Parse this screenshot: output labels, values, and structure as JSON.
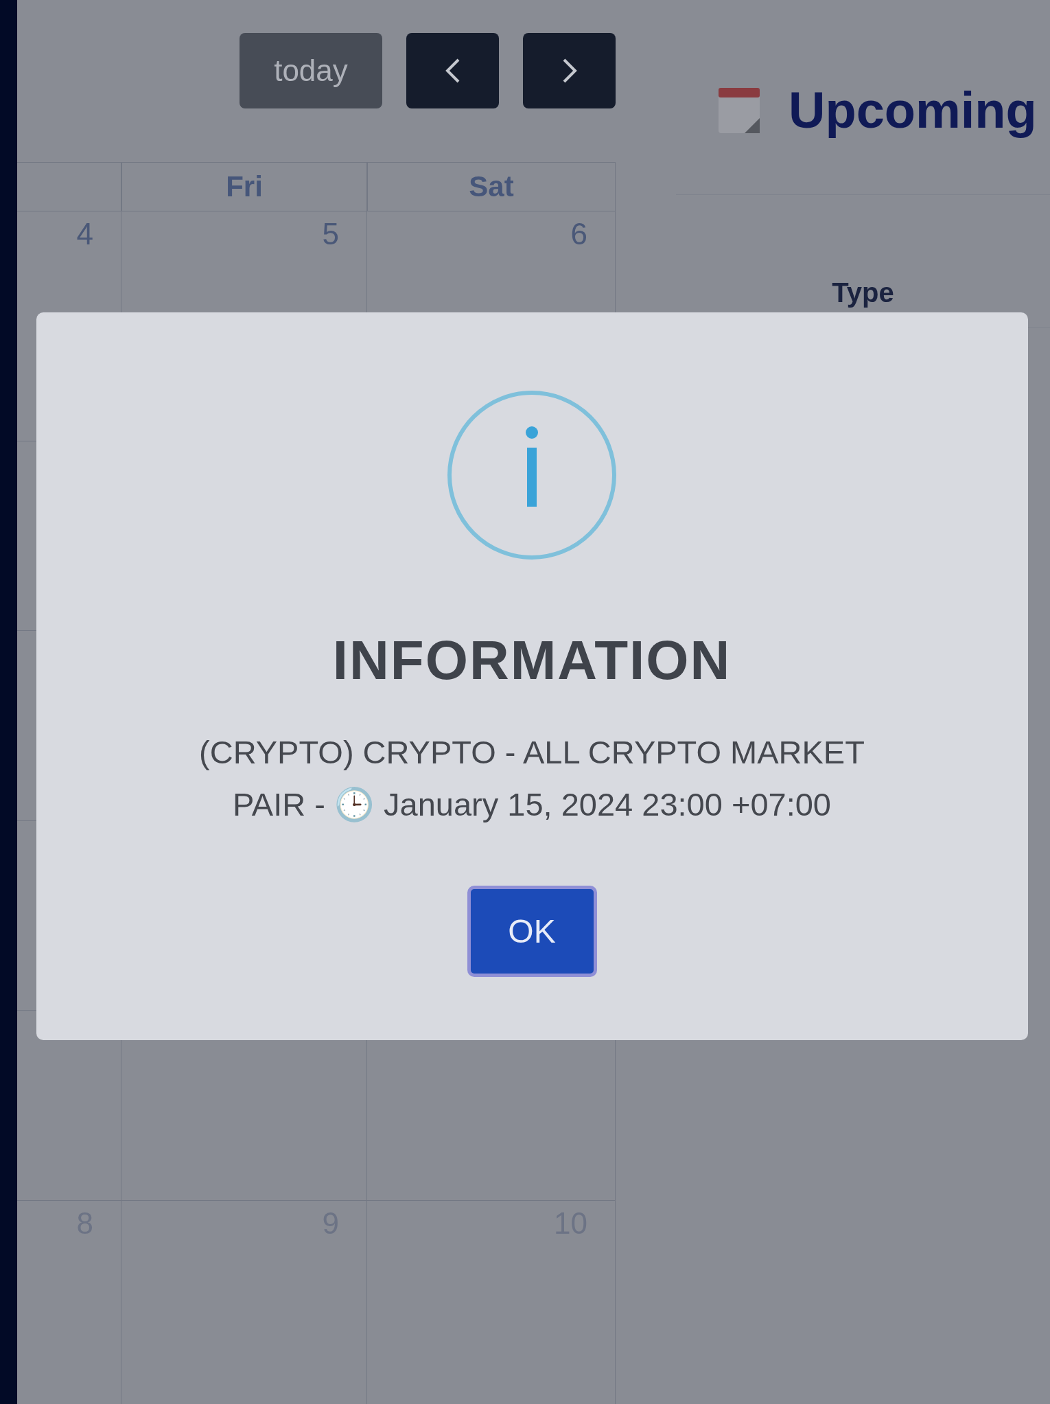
{
  "calendar": {
    "today_button": {
      "label": "today",
      "disabled": true
    },
    "columns": [
      {
        "label": "Fri"
      },
      {
        "label": "Sat"
      }
    ],
    "weeks": [
      {
        "days": [
          "4",
          "5",
          "6"
        ],
        "muted": false
      },
      {
        "days": [
          "8",
          "9",
          "10"
        ],
        "muted": true
      }
    ]
  },
  "upcoming": {
    "title": "Upcoming",
    "columns": [
      "Type"
    ]
  },
  "dialog": {
    "kind": "info",
    "title": "INFORMATION",
    "message": "(CRYPTO) CRYPTO - ALL CRYPTO MARKET PAIR - 🕒 January 15, 2024 23:00 +07:00",
    "confirm": "OK"
  }
}
